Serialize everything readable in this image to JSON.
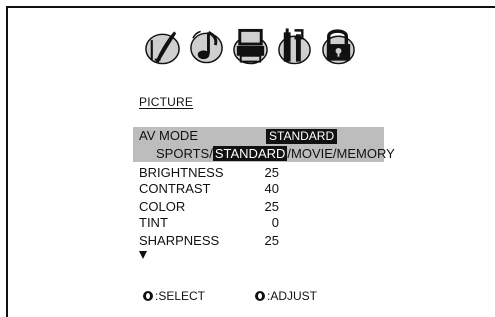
{
  "icons": [
    "picture-icon",
    "audio-icon",
    "tv-setup-icon",
    "tools-icon",
    "lock-icon"
  ],
  "menu": {
    "title": "PICTURE",
    "av_mode": {
      "label": "AV MODE",
      "value": "STANDARD",
      "options": [
        "SPORTS",
        "STANDARD",
        "MOVIE",
        "MEMORY"
      ],
      "separator": "/",
      "selected_index": 1
    },
    "settings": [
      {
        "label": "BRIGHTNESS",
        "value": "25"
      },
      {
        "label": "CONTRAST",
        "value": "40"
      },
      {
        "label": "COLOR",
        "value": "25"
      },
      {
        "label": "TINT",
        "value": "0"
      },
      {
        "label": "SHARPNESS",
        "value": "25"
      }
    ]
  },
  "footer": {
    "select_label": ":SELECT",
    "adjust_label": ":ADJUST"
  },
  "colors": {
    "highlight_bg": "#bdbdbd",
    "inverse_bg": "#111111",
    "text": "#111111"
  }
}
